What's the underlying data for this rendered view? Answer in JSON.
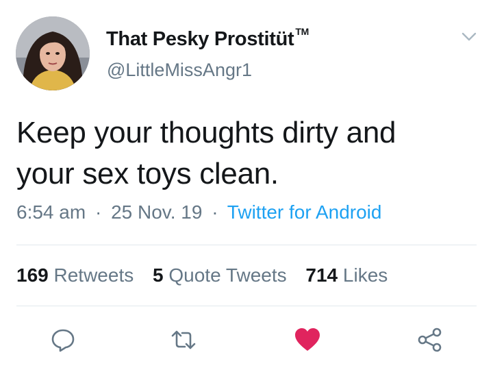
{
  "user": {
    "display_name": "That Pesky Prostitüt",
    "trademark": "TM",
    "handle": "@LittleMissAngr1"
  },
  "tweet": {
    "text_line1": "Keep your thoughts dirty and",
    "text_line2": "your sex toys clean.",
    "time": "6:54 am",
    "date": "25 Nov. 19",
    "source": "Twitter for Android",
    "separator": "·"
  },
  "stats": {
    "retweets_count": "169",
    "retweets_label": "Retweets",
    "quotes_count": "5",
    "quotes_label": "Quote Tweets",
    "likes_count": "714",
    "likes_label": "Likes"
  },
  "actions": [
    {
      "icon": "reply-icon"
    },
    {
      "icon": "retweet-icon"
    },
    {
      "icon": "like-icon",
      "state": "liked"
    },
    {
      "icon": "share-icon"
    }
  ],
  "colors": {
    "text": "#14171a",
    "secondary": "#657786",
    "link": "#1da1f2",
    "like": "#e0245e",
    "divider": "#e1e8ed"
  }
}
